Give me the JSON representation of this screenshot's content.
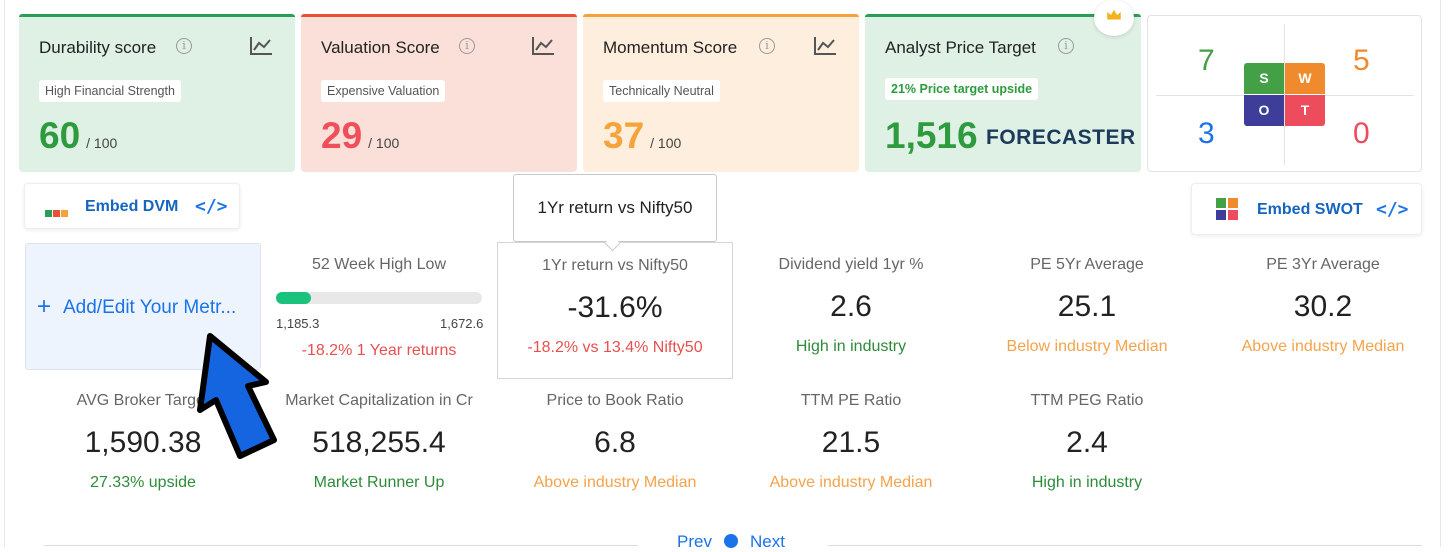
{
  "cards": [
    {
      "title": "Durability score",
      "badge": "High Financial Strength",
      "score": "60",
      "outof": "/ 100",
      "bg": "#dff1e5",
      "accent": "#2a9d57",
      "score_color": "#2e9b3e"
    },
    {
      "title": "Valuation Score",
      "badge": "Expensive Valuation",
      "score": "29",
      "outof": "/ 100",
      "bg": "#fbe0d9",
      "accent": "#e8503a",
      "score_color": "#ef4f5a"
    },
    {
      "title": "Momentum Score",
      "badge": "Technically Neutral",
      "score": "37",
      "outof": "/ 100",
      "bg": "#fdeedd",
      "accent": "#f5a23b",
      "score_color": "#f5a33b"
    },
    {
      "title": "Analyst Price Target",
      "badge": "21% Price target upside",
      "target": "1,516",
      "brand": "FORECASTER",
      "bg": "#dff1e5",
      "accent": "#2a9d57",
      "score_color": "#2e9b3e"
    }
  ],
  "swot": {
    "s_count": "7",
    "w_count": "5",
    "o_count": "3",
    "t_count": "0",
    "s": "S",
    "w": "W",
    "o": "O",
    "t": "T",
    "colors": {
      "s": "#43a047",
      "w": "#ef8b2c",
      "o": "#3f3d9a",
      "t": "#ec4c5c"
    }
  },
  "embed_dvm": {
    "label": "Embed DVM"
  },
  "embed_swot": {
    "label": "Embed SWOT"
  },
  "tooltip": "1Yr return vs Nifty50",
  "add_metric": {
    "label": "Add/Edit Your Metr..."
  },
  "week52": {
    "label": "52 Week High Low",
    "low": "1,185.3",
    "high": "1,672.6",
    "sub": "-18.2% 1 Year returns",
    "progress": 0.1
  },
  "metrics": [
    {
      "label": "1Yr return vs Nifty50",
      "value": "-31.6%",
      "sub": "-18.2% vs 13.4% Nifty50"
    },
    {
      "label": "Dividend yield 1yr %",
      "value": "2.6",
      "sub": "High in industry"
    },
    {
      "label": "PE 5Yr Average",
      "value": "25.1",
      "sub": "Below industry Median"
    },
    {
      "label": "PE 3Yr Average",
      "value": "30.2",
      "sub": "Above industry Median"
    },
    {
      "label": "AVG Broker Target",
      "value": "1,590.38",
      "sub": "27.33% upside"
    },
    {
      "label": "Market Capitalization in Cr",
      "value": "518,255.4",
      "sub": "Market Runner Up"
    },
    {
      "label": "Price to Book Ratio",
      "value": "6.8",
      "sub": "Above industry Median"
    },
    {
      "label": "TTM PE Ratio",
      "value": "21.5",
      "sub": "Above industry Median"
    },
    {
      "label": "TTM PEG Ratio",
      "value": "2.4",
      "sub": "High in industry"
    }
  ],
  "pager": {
    "prev": "Prev",
    "next": "Next"
  }
}
